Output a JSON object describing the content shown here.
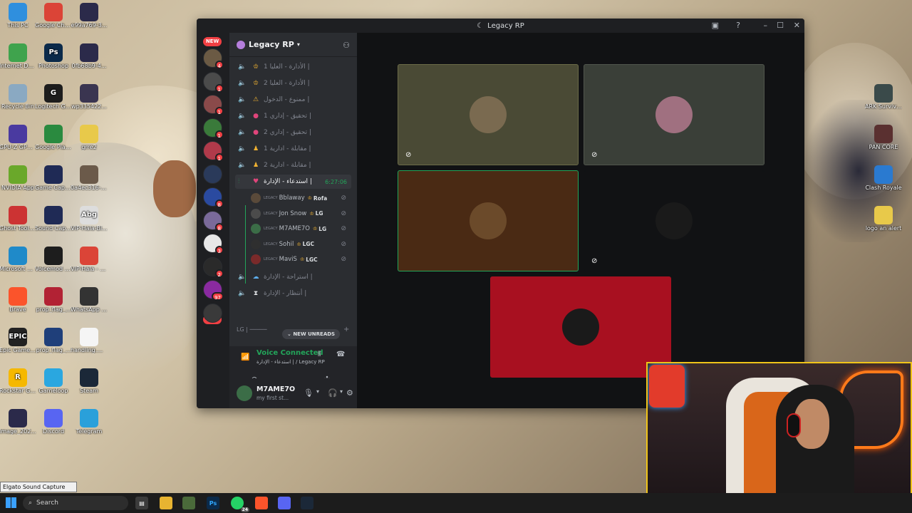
{
  "desktop": {
    "left_icons": [
      {
        "label": "This PC",
        "color": "#2f8fde",
        "glyph": ""
      },
      {
        "label": "Google Chrome",
        "color": "#db4437",
        "glyph": ""
      },
      {
        "label": "e99a769-3...",
        "color": "#2b2a4a",
        "glyph": ""
      },
      {
        "label": "Internet Downlo...",
        "color": "#3fa34d",
        "glyph": ""
      },
      {
        "label": "Photoshop",
        "color": "#0b2a4a",
        "glyph": "Ps"
      },
      {
        "label": "0fb68b9-4...",
        "color": "#2b2a4a",
        "glyph": ""
      },
      {
        "label": "Recycle Bin",
        "color": "#8aa9c2",
        "glyph": ""
      },
      {
        "label": "Logitech G HUB",
        "color": "#1d1d1d",
        "glyph": "G"
      },
      {
        "label": "wp335422...",
        "color": "#3a3550",
        "glyph": ""
      },
      {
        "label": "GPU-Z GPU-Z",
        "color": "#4a3aa0",
        "glyph": ""
      },
      {
        "label": "Google Play Games",
        "color": "#2a8a3f",
        "glyph": ""
      },
      {
        "label": "grre2",
        "color": "#e8c94a",
        "glyph": ""
      },
      {
        "label": "NVIDIA App",
        "color": "#6aa82a",
        "glyph": ""
      },
      {
        "label": "Game Capture HD",
        "color": "#1f2a55",
        "glyph": ""
      },
      {
        "label": "0a4ec316-3...",
        "color": "#6b5a4a",
        "glyph": ""
      },
      {
        "label": "Ghost Toolbox",
        "color": "#c33",
        "glyph": ""
      },
      {
        "label": "Sound Capture",
        "color": "#1f2a55",
        "glyph": ""
      },
      {
        "label": "VIP-Hala-Bi...",
        "color": "#ddd",
        "glyph": "Abg"
      },
      {
        "label": "Microsoft Edge",
        "color": "#1f8ac9",
        "glyph": ""
      },
      {
        "label": "Voicemod V3",
        "color": "#1d1d1d",
        "glyph": ""
      },
      {
        "label": "VIP-Hala - Chrome",
        "color": "#db4437",
        "glyph": ""
      },
      {
        "label": "Brave",
        "color": "#fb542b",
        "glyph": ""
      },
      {
        "label": "prop_flag_...",
        "color": "#b22234",
        "glyph": ""
      },
      {
        "label": "WhatsApp Image 2026...",
        "color": "#333",
        "glyph": ""
      },
      {
        "label": "Epic Games Launcher",
        "color": "#222",
        "glyph": "EPIC"
      },
      {
        "label": "prop_flag_...",
        "color": "#1f3f7a",
        "glyph": ""
      },
      {
        "label": "handling.m...",
        "color": "#f5f5f5",
        "glyph": ""
      },
      {
        "label": "Rockstar Games ...",
        "color": "#f5b800",
        "glyph": "R"
      },
      {
        "label": "Gameloop",
        "color": "#2aa7e0",
        "glyph": ""
      },
      {
        "label": "Steam",
        "color": "#1b2838",
        "glyph": ""
      },
      {
        "label": "Image_202...",
        "color": "#2b2a4a",
        "glyph": ""
      },
      {
        "label": "Discord",
        "color": "#5865f2",
        "glyph": ""
      },
      {
        "label": "Telegram",
        "color": "#2aa0da",
        "glyph": ""
      }
    ],
    "right_icons": [
      {
        "label": "ARK Survival Evolved",
        "color": "#3a4a4a",
        "glyph": ""
      },
      {
        "label": "PAN CORE",
        "color": "#5a3030",
        "glyph": ""
      },
      {
        "label": "Clash Royale",
        "color": "#2a7ad0",
        "glyph": ""
      },
      {
        "label": "logo an alert",
        "color": "#e8c94a",
        "glyph": ""
      }
    ],
    "tooltip": "Elgato Sound Capture"
  },
  "discord": {
    "window_title": "Legacy RP",
    "server_name": "Legacy RP",
    "new_label": "NEW",
    "server_badges": [
      "4",
      "1",
      "1",
      "1",
      "1",
      "",
      "8",
      "8",
      "3",
      "2",
      "97",
      ""
    ],
    "channels": [
      {
        "emoji": "♔",
        "name": "الأدارة - العليا 1 |",
        "emoji_color": "#f0b232"
      },
      {
        "emoji": "♔",
        "name": "الأدارة - العليا 2 |",
        "emoji_color": "#f0b232"
      },
      {
        "emoji": "⚠",
        "name": "ممنوع - الدخول |",
        "emoji_color": "#f0b232"
      },
      {
        "emoji": "●",
        "name": "تحقيق - إداري 1 |",
        "emoji_color": "#e0457b"
      },
      {
        "emoji": "●",
        "name": "تحقيق - إداري 2 |",
        "emoji_color": "#e0457b"
      },
      {
        "emoji": "♟",
        "name": "مقابلة - ادارية 1 |",
        "emoji_color": "#f0b232"
      },
      {
        "emoji": "♟",
        "name": "مقابلة - ادارية 2 |",
        "emoji_color": "#f0b232"
      }
    ],
    "active_channel": {
      "emoji": "♥",
      "name": "استدعاء - الإدارة |",
      "time": "6:27:06"
    },
    "voice_users": [
      {
        "tag": "LEGACY",
        "name": "Bblaway",
        "extra": "Rofa",
        "avatar": "#5a4a3a",
        "crown": "♔"
      },
      {
        "tag": "LEGACY",
        "name": "Jon Snow",
        "extra": "LG",
        "avatar": "#4b4b4b",
        "crown": "♔"
      },
      {
        "tag": "LEGACY",
        "name": "M7AME7O",
        "extra": "LG",
        "avatar": "#3b6d47",
        "crown": "♔"
      },
      {
        "tag": "LEGACY",
        "name": "Sohil",
        "extra": "LGC",
        "avatar": "#2f2f2f",
        "crown": "♔"
      },
      {
        "tag": "LEGACY",
        "name": "MaviS",
        "extra": "LGC",
        "avatar": "#7a2a2a",
        "crown": "♔"
      }
    ],
    "after_channels": [
      {
        "emoji": "☁",
        "name": "استراحة - الإدارة |",
        "emoji_color": "#5dadec"
      },
      {
        "emoji": "⧗",
        "name": "أنتظار - الإدارة |",
        "emoji_color": "#dbdee1"
      }
    ],
    "category_label": "LG | ─────",
    "unreads_label": "NEW UNREADS",
    "voice_status": "Voice Connected",
    "voice_channel": "استدعاء - الإدارة | / Legacy RP",
    "username": "M7AME7O",
    "user_status": "my first st...",
    "video_tiles": [
      {
        "bg": "#4a4a35",
        "border": "#6b6b48",
        "avatar": "#7a6a50",
        "muted": true
      },
      {
        "bg": "#3a3f38",
        "border": "#50554c",
        "avatar": "#a07080",
        "muted": true
      },
      {
        "bg": "#4a2a14",
        "border": "#23a55a",
        "avatar": "#6b4a2a",
        "muted": false
      },
      {
        "bg": "#111214",
        "border": "#111214",
        "avatar": "#1a1a1a",
        "muted": true
      },
      {
        "bg": "#a81020",
        "border": "#a81020",
        "avatar": "#1a1a1a",
        "muted": false
      }
    ]
  },
  "taskbar": {
    "search_placeholder": "Search",
    "whatsapp_badge": "24"
  }
}
